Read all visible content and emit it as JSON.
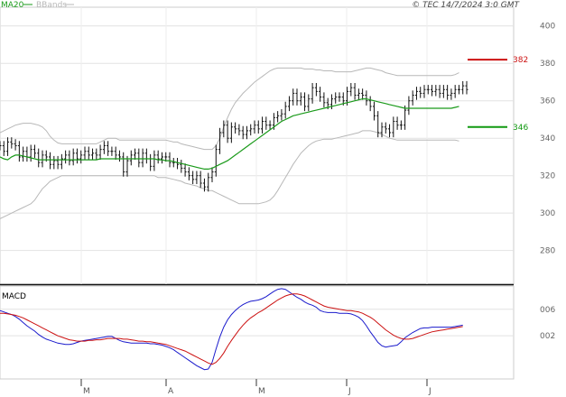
{
  "chart_data": [
    {
      "type": "line",
      "name": "price",
      "title": "",
      "legend": [
        {
          "label": "MA20",
          "color": "#1a9a1a"
        },
        {
          "label": "BBands",
          "color": "#b8b8b8"
        }
      ],
      "legend_placement": "top-left",
      "copyright": "© TEC 14/7/2024 3:0 GMT",
      "x_ticks": [
        "M",
        "A",
        "M",
        "J",
        "J"
      ],
      "y_ticks": [
        280,
        300,
        320,
        340,
        360,
        380,
        400
      ],
      "ylim": [
        262,
        410
      ],
      "grid": true,
      "levels": [
        {
          "label": "382",
          "value": 382,
          "color": "#cc1111"
        },
        {
          "label": "346",
          "value": 346,
          "color": "#119911"
        }
      ],
      "price_close": [
        336,
        333,
        338,
        337,
        336,
        330,
        333,
        330,
        334,
        332,
        327,
        331,
        330,
        326,
        328,
        326,
        329,
        331,
        328,
        332,
        329,
        331,
        333,
        331,
        332,
        331,
        334,
        336,
        333,
        333,
        331,
        330,
        322,
        328,
        331,
        332,
        327,
        332,
        329,
        325,
        331,
        329,
        330,
        330,
        327,
        327,
        326,
        324,
        322,
        320,
        318,
        320,
        316,
        314,
        319,
        322,
        334,
        343,
        347,
        340,
        346,
        345,
        344,
        342,
        344,
        345,
        347,
        345,
        349,
        347,
        347,
        351,
        352,
        353,
        357,
        360,
        364,
        360,
        362,
        357,
        361,
        367,
        365,
        362,
        359,
        358,
        361,
        362,
        362,
        360,
        365,
        367,
        363,
        364,
        363,
        360,
        357,
        352,
        343,
        346,
        345,
        343,
        349,
        347,
        347,
        355,
        360,
        363,
        365,
        364,
        366,
        366,
        365,
        366,
        364,
        366,
        363,
        364,
        366,
        366,
        368,
        366
      ],
      "ma20": [
        330,
        329,
        328.5,
        330,
        331,
        331,
        330.5,
        330,
        329.5,
        329,
        328.5,
        328.5,
        328.5,
        328.5,
        328.5,
        328.5,
        328.5,
        328.5,
        328.5,
        328.5,
        328.5,
        328.5,
        328.5,
        328.5,
        328.5,
        328.5,
        329,
        329,
        329,
        329,
        329,
        329,
        329,
        329,
        329,
        329,
        329,
        329,
        329,
        329,
        329,
        328.5,
        328.5,
        328,
        328,
        327.5,
        327,
        326.5,
        326,
        325.5,
        325,
        324.5,
        324,
        323.5,
        323.5,
        324,
        325,
        326,
        327,
        328,
        329.5,
        331,
        332.5,
        334,
        335.5,
        337,
        338.5,
        340,
        341.5,
        343,
        344.5,
        346,
        347.5,
        349,
        350,
        351,
        352,
        352.5,
        353,
        353.5,
        354,
        354.5,
        355,
        355.5,
        356,
        356.5,
        357,
        357.5,
        358,
        358.5,
        359,
        359.5,
        360,
        360.5,
        361,
        361,
        360.5,
        360,
        359.5,
        359,
        358.5,
        358,
        357.5,
        357,
        356.5,
        356,
        356,
        356,
        356,
        356,
        356,
        356,
        356,
        356,
        356,
        356,
        356,
        356,
        356.5,
        357
      ],
      "bb_upper": [
        343,
        344,
        345,
        346,
        347,
        347.5,
        348,
        348,
        348,
        347.5,
        347,
        346,
        344,
        341,
        339,
        337.5,
        337,
        337,
        337,
        337,
        337,
        337,
        337,
        337,
        337,
        337,
        338,
        339,
        340,
        340,
        340,
        339,
        339,
        339,
        339,
        339,
        339,
        339,
        339,
        339,
        339,
        339,
        339,
        339,
        338.5,
        338,
        338,
        337,
        336.5,
        336,
        335.5,
        335,
        334.5,
        334,
        334,
        334,
        336,
        340,
        346,
        351,
        355.5,
        359,
        361.5,
        364,
        366,
        368,
        370,
        371.5,
        373,
        374.5,
        376,
        377,
        377.5,
        377.5,
        377.5,
        377.5,
        377.5,
        377.5,
        377.5,
        377,
        377,
        377,
        376.5,
        376.5,
        376,
        376,
        376,
        375.5,
        375.5,
        375.5,
        375.5,
        375.5,
        376,
        376.5,
        377,
        377.5,
        377.5,
        377,
        376.5,
        376,
        375,
        374.5,
        374,
        373.5,
        373.5,
        373.5,
        373.5,
        373.5,
        373.5,
        373.5,
        373.5,
        373.5,
        373.5,
        373.5,
        373.5,
        373.5,
        373.5,
        373.5,
        374,
        375
      ],
      "bb_lower": [
        297,
        298,
        299,
        300,
        301,
        302,
        303,
        304,
        305,
        307,
        310,
        313,
        315,
        317,
        318,
        319,
        320,
        320,
        320,
        320,
        320,
        320,
        320,
        320,
        320,
        320,
        320,
        320,
        320,
        320,
        320,
        320,
        320,
        320,
        320,
        320,
        320,
        320,
        320,
        320,
        320,
        319,
        319,
        319,
        318.5,
        318,
        317.5,
        317,
        316,
        315.5,
        315,
        314.5,
        313.5,
        313,
        312,
        312,
        311,
        310,
        309,
        308,
        307,
        306,
        305,
        305,
        305,
        305,
        305,
        305,
        305.5,
        306,
        307,
        309,
        312,
        315.5,
        319,
        322.5,
        326,
        329,
        332,
        334,
        336,
        337.5,
        338.5,
        339,
        339.5,
        339.5,
        339.5,
        340,
        340.5,
        341,
        341.5,
        342,
        342.5,
        343,
        344,
        344,
        344,
        343.5,
        343,
        342,
        341,
        340,
        339.5,
        339,
        339,
        339,
        339,
        339,
        339,
        339,
        339,
        339,
        339,
        339,
        339,
        339,
        339,
        339,
        339,
        338.5
      ]
    },
    {
      "type": "line",
      "name": "macd",
      "title": "",
      "legend": [
        {
          "label": "MACD",
          "color": "#000000"
        }
      ],
      "legend_placement": "top-left",
      "x_ticks": [
        "M",
        "A",
        "M",
        "J",
        "J"
      ],
      "y_ticks": [
        0.02,
        0.06
      ],
      "y_tick_labels": [
        "002",
        "006"
      ],
      "ylim": [
        -0.045,
        0.095
      ],
      "grid": true,
      "macd": [
        0.058,
        0.056,
        0.054,
        0.052,
        0.049,
        0.045,
        0.04,
        0.035,
        0.031,
        0.027,
        0.022,
        0.018,
        0.015,
        0.013,
        0.011,
        0.009,
        0.008,
        0.007,
        0.007,
        0.008,
        0.01,
        0.012,
        0.013,
        0.014,
        0.015,
        0.016,
        0.017,
        0.018,
        0.019,
        0.019,
        0.016,
        0.013,
        0.011,
        0.01,
        0.009,
        0.009,
        0.009,
        0.009,
        0.009,
        0.008,
        0.008,
        0.007,
        0.006,
        0.004,
        0.002,
        -0.001,
        -0.005,
        -0.009,
        -0.013,
        -0.017,
        -0.021,
        -0.025,
        -0.028,
        -0.031,
        -0.03,
        -0.02,
        0.0,
        0.018,
        0.033,
        0.044,
        0.052,
        0.058,
        0.063,
        0.067,
        0.07,
        0.072,
        0.073,
        0.074,
        0.076,
        0.079,
        0.083,
        0.087,
        0.09,
        0.091,
        0.09,
        0.086,
        0.082,
        0.078,
        0.075,
        0.071,
        0.068,
        0.066,
        0.063,
        0.058,
        0.056,
        0.055,
        0.055,
        0.055,
        0.054,
        0.054,
        0.054,
        0.053,
        0.051,
        0.048,
        0.043,
        0.035,
        0.026,
        0.018,
        0.01,
        0.005,
        0.003,
        0.004,
        0.005,
        0.006,
        0.011,
        0.017,
        0.021,
        0.025,
        0.028,
        0.031,
        0.032,
        0.032,
        0.033,
        0.033,
        0.033,
        0.033,
        0.033,
        0.033,
        0.034,
        0.035,
        0.036
      ],
      "signal": [
        0.054,
        0.054,
        0.053,
        0.052,
        0.051,
        0.049,
        0.047,
        0.044,
        0.041,
        0.038,
        0.035,
        0.032,
        0.029,
        0.026,
        0.023,
        0.02,
        0.018,
        0.016,
        0.014,
        0.013,
        0.012,
        0.012,
        0.012,
        0.013,
        0.013,
        0.014,
        0.014,
        0.015,
        0.016,
        0.016,
        0.016,
        0.016,
        0.015,
        0.015,
        0.014,
        0.013,
        0.012,
        0.012,
        0.011,
        0.011,
        0.01,
        0.009,
        0.008,
        0.007,
        0.005,
        0.003,
        0.001,
        -0.001,
        -0.003,
        -0.006,
        -0.009,
        -0.012,
        -0.015,
        -0.018,
        -0.021,
        -0.023,
        -0.02,
        -0.014,
        -0.006,
        0.004,
        0.013,
        0.021,
        0.029,
        0.036,
        0.042,
        0.047,
        0.051,
        0.055,
        0.058,
        0.062,
        0.066,
        0.07,
        0.074,
        0.077,
        0.08,
        0.082,
        0.083,
        0.083,
        0.082,
        0.08,
        0.077,
        0.074,
        0.071,
        0.068,
        0.065,
        0.063,
        0.062,
        0.061,
        0.06,
        0.059,
        0.058,
        0.058,
        0.057,
        0.056,
        0.054,
        0.051,
        0.048,
        0.044,
        0.039,
        0.034,
        0.029,
        0.025,
        0.021,
        0.018,
        0.016,
        0.015,
        0.015,
        0.016,
        0.018,
        0.02,
        0.022,
        0.024,
        0.026,
        0.027,
        0.028,
        0.029,
        0.03,
        0.031,
        0.032,
        0.033,
        0.034
      ]
    }
  ]
}
